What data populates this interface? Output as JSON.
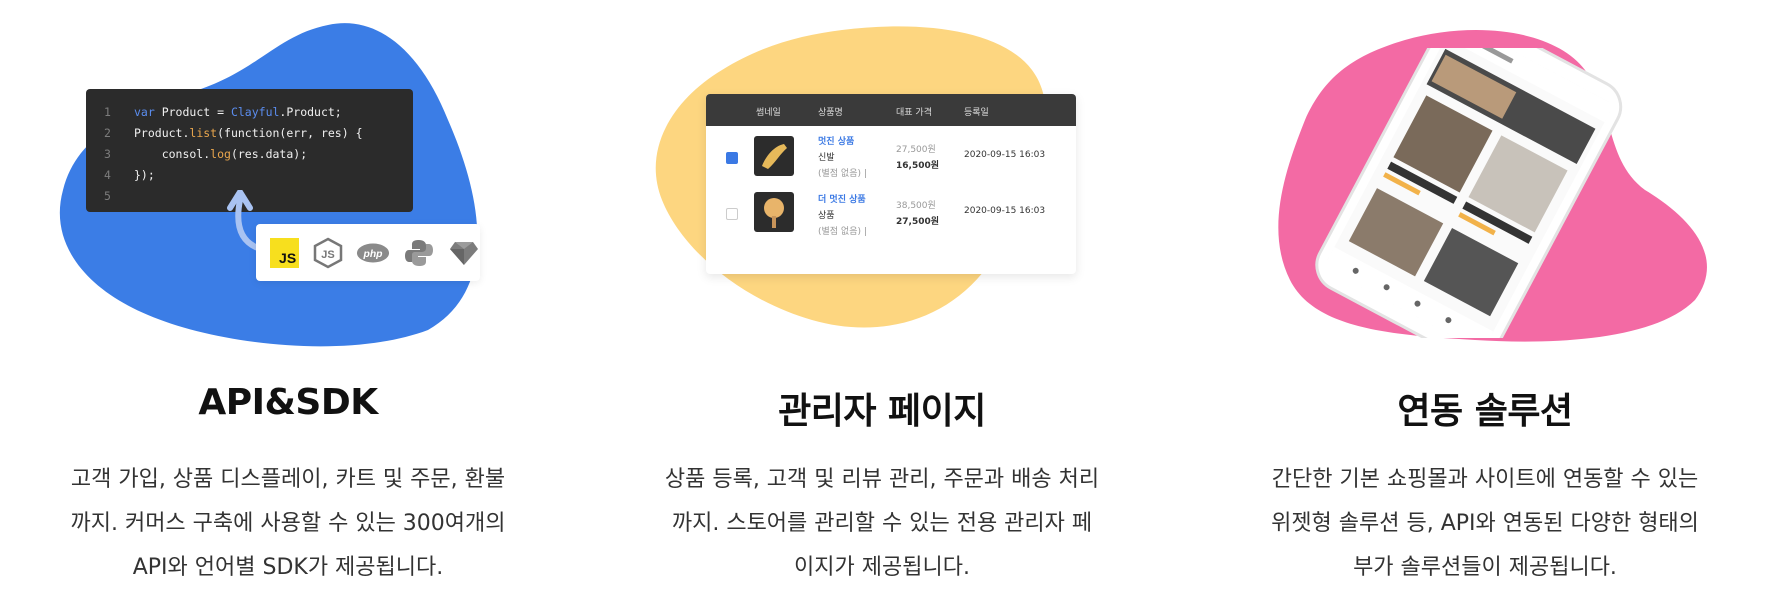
{
  "features": [
    {
      "title": "API&SDK",
      "desc_lines": [
        "고객 가입, 상품 디스플레이, 카트 및 주문, 환불",
        "까지. 커머스 구축에 사용할 수 있는 300여개의",
        "API와 언어별 SDK가 제공됩니다."
      ],
      "blob_color": "#3b7de6",
      "code_lines": [
        {
          "num": "1",
          "a": "var",
          "b": " Product = ",
          "c": "Clayful",
          "d": ".Product;"
        },
        {
          "num": "2",
          "a": "",
          "b": "Product.",
          "c": "list",
          "d": "(function(err, res) {"
        },
        {
          "num": "3",
          "a": "",
          "b": "    consol.",
          "c": "log",
          "d": "(res.data);"
        },
        {
          "num": "4",
          "a": "",
          "b": "});",
          "c": "",
          "d": ""
        },
        {
          "num": "5",
          "a": "",
          "b": "",
          "c": "",
          "d": ""
        }
      ],
      "sdk_icons": [
        "js-icon",
        "nodejs-icon",
        "php-icon",
        "python-icon",
        "ruby-icon"
      ],
      "js_label": "JS",
      "php_label": "php"
    },
    {
      "title": "관리자 페이지",
      "desc_lines": [
        "상품 등록, 고객 및 리뷰 관리, 주문과 배송 처리",
        "까지. 스토어를 관리할 수 있는 전용 관리자 페",
        "이지가 제공됩니다."
      ],
      "blob_color": "#fdd680",
      "table_headers": [
        "썸네일",
        "상품명",
        "대표 가격",
        "등록일"
      ],
      "rows": [
        {
          "name": "멋진 상품",
          "status": "신발",
          "note": "(별점 없음)  |",
          "price_orig": "27,500원",
          "price": "16,500원",
          "date": "2020-09-15 16:03",
          "checked": true
        },
        {
          "name": "더 멋진 상품",
          "status": "상품",
          "note": "(별점 없음)  |",
          "price_orig": "38,500원",
          "price": "27,500원",
          "date": "2020-09-15 16:03",
          "checked": false
        }
      ]
    },
    {
      "title": "연동 솔루션",
      "desc_lines": [
        "간단한 기본 쇼핑몰과 사이트에 연동할 수 있는",
        "위젯형 솔루션 등, API와 연동된 다양한 형태의",
        "부가 솔루션들이 제공됩니다."
      ],
      "blob_color": "#f36aa4"
    }
  ]
}
